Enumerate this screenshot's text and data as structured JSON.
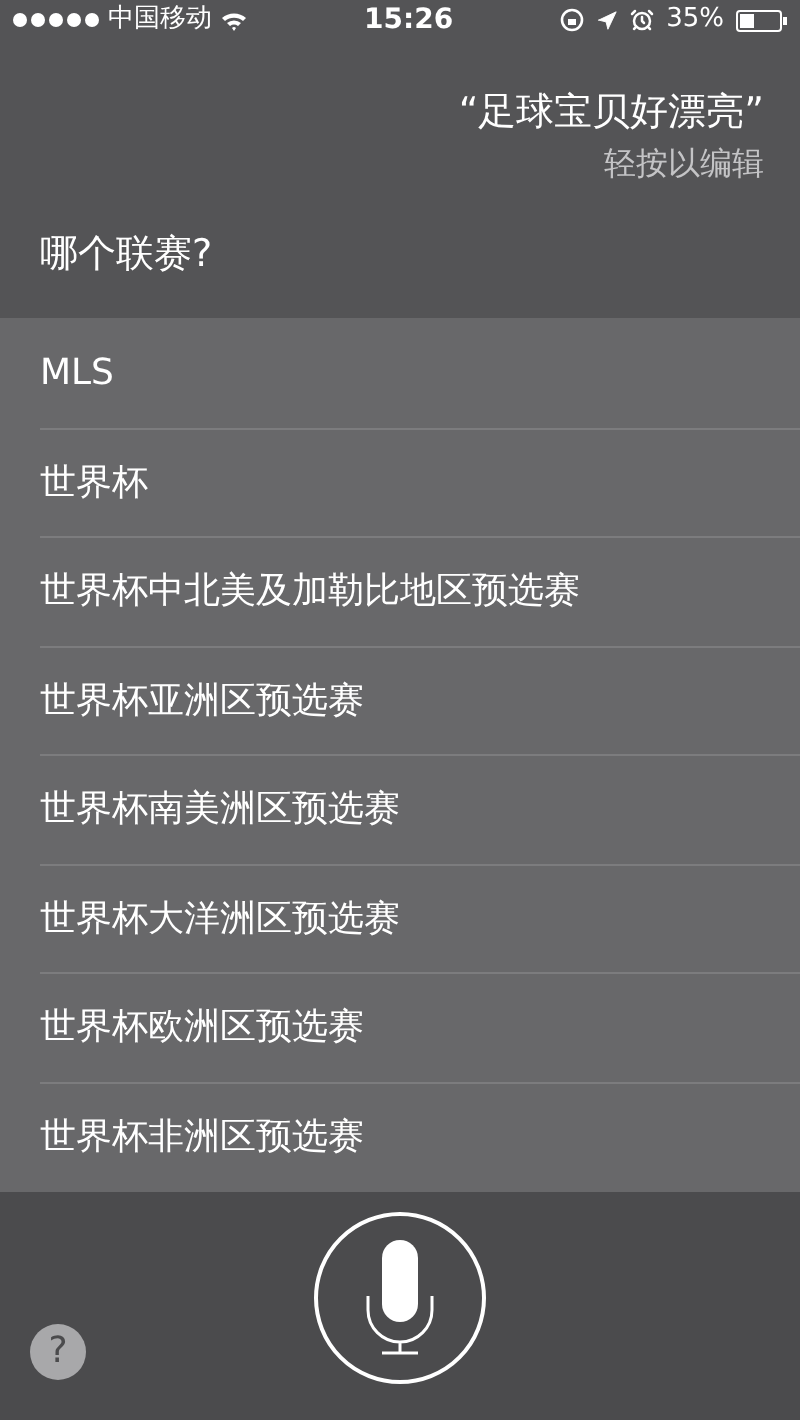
{
  "status_bar": {
    "carrier": "中国移动",
    "time": "15:26",
    "battery": "35%"
  },
  "utterance": {
    "text": "“足球宝贝好漂亮”",
    "hint": "轻按以编辑"
  },
  "question": "哪个联赛?",
  "options": [
    {
      "label": "MLS"
    },
    {
      "label": "世界杯"
    },
    {
      "label": "世界杯中北美及加勒比地区预选赛"
    },
    {
      "label": "世界杯亚洲区预选赛"
    },
    {
      "label": "世界杯南美洲区预选赛"
    },
    {
      "label": "世界杯大洋洲区预选赛"
    },
    {
      "label": "世界杯欧洲区预选赛"
    },
    {
      "label": "世界杯非洲区预选赛"
    }
  ],
  "help_button": "?"
}
